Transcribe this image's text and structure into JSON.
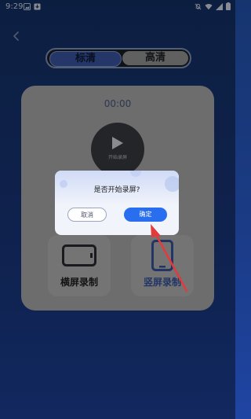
{
  "status_bar": {
    "time": "9:29"
  },
  "quality_tabs": [
    {
      "label": "标清",
      "active": true
    },
    {
      "label": "高清",
      "active": false
    }
  ],
  "timer": "00:00",
  "record_button": {
    "label": "开始录屏"
  },
  "modes": [
    {
      "label": "横屏录制"
    },
    {
      "label": "竖屏录制"
    }
  ],
  "dialog": {
    "title": "是否开始录屏?",
    "cancel_label": "取消",
    "confirm_label": "确定"
  },
  "colors": {
    "accent": "#2a6ef0",
    "annotation_arrow": "#e23b3b",
    "background": "#1b3b86"
  }
}
